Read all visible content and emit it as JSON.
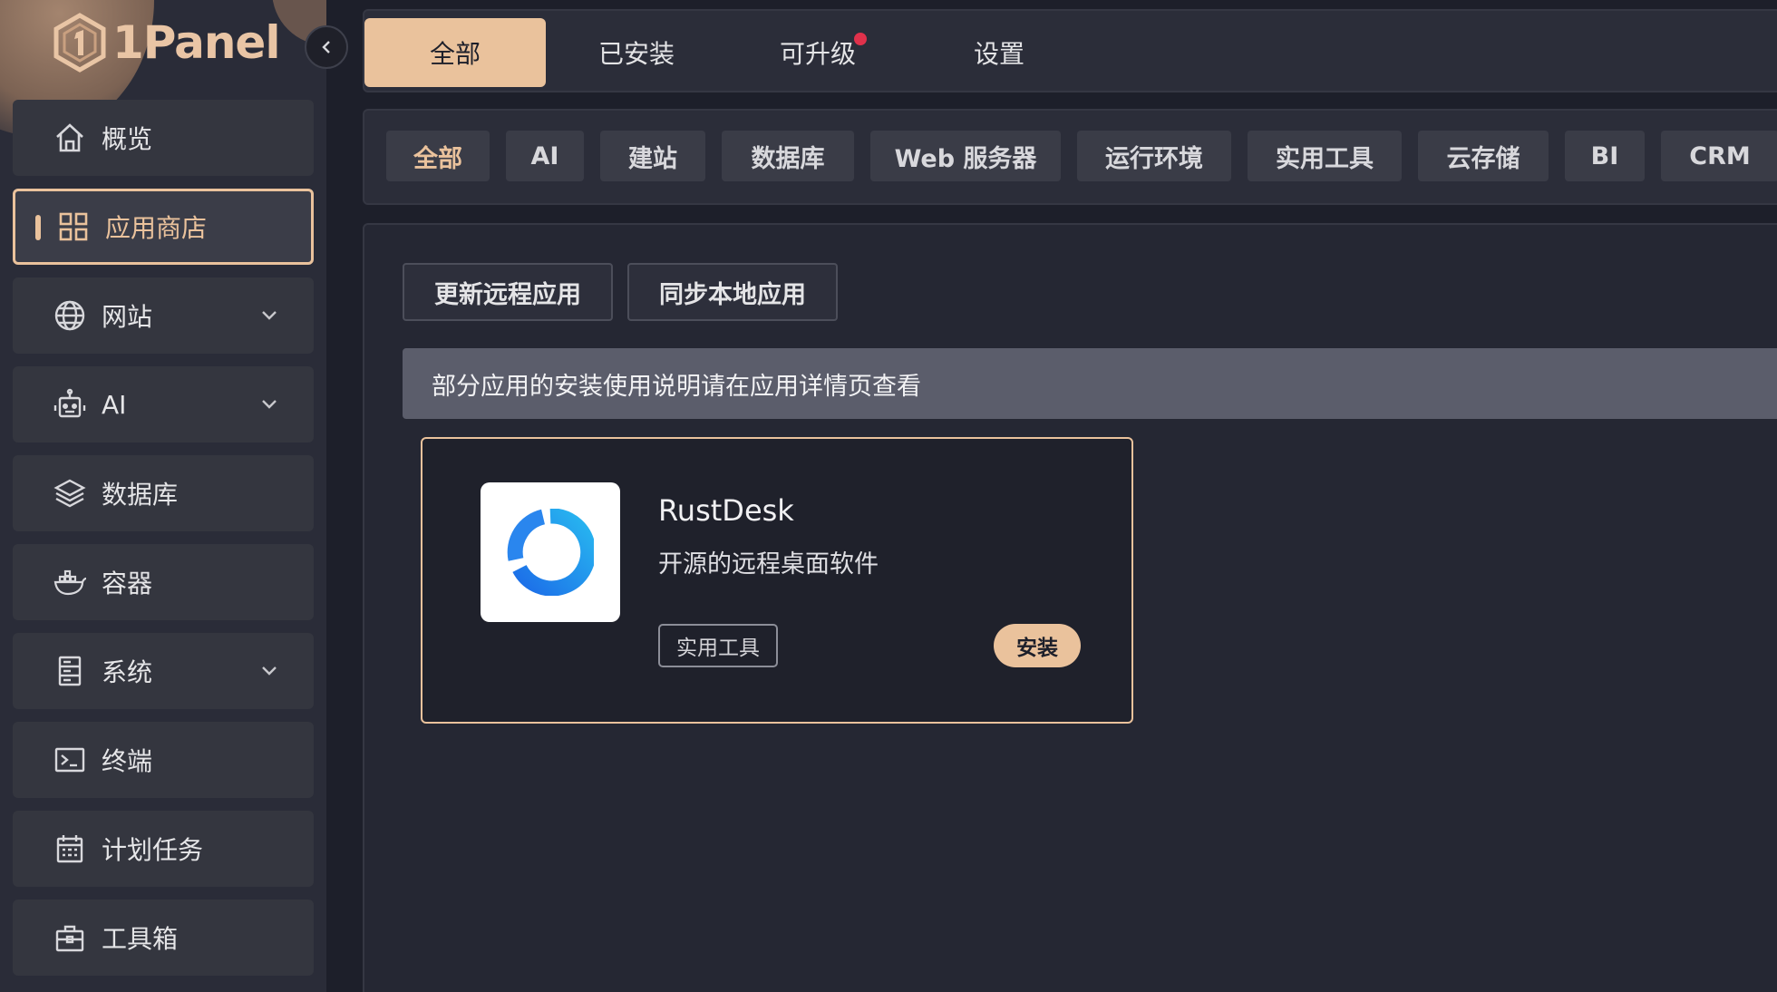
{
  "app": {
    "logo_text": "1Panel"
  },
  "sidebar": {
    "items": [
      {
        "label": "概览",
        "icon": "home-icon",
        "expandable": false
      },
      {
        "label": "应用商店",
        "icon": "apps-grid-icon",
        "expandable": false,
        "active": true
      },
      {
        "label": "网站",
        "icon": "globe-icon",
        "expandable": true
      },
      {
        "label": "AI",
        "icon": "robot-icon",
        "expandable": true
      },
      {
        "label": "数据库",
        "icon": "layers-icon",
        "expandable": false
      },
      {
        "label": "容器",
        "icon": "docker-icon",
        "expandable": false
      },
      {
        "label": "系统",
        "icon": "server-icon",
        "expandable": true
      },
      {
        "label": "终端",
        "icon": "terminal-icon",
        "expandable": false
      },
      {
        "label": "计划任务",
        "icon": "calendar-icon",
        "expandable": false
      },
      {
        "label": "工具箱",
        "icon": "toolbox-icon",
        "expandable": false
      }
    ]
  },
  "tabs": [
    {
      "label": "全部",
      "active": true
    },
    {
      "label": "已安装"
    },
    {
      "label": "可升级",
      "badge_dot": true
    },
    {
      "label": "设置"
    }
  ],
  "categories": [
    "全部",
    "AI",
    "建站",
    "数据库",
    "Web 服务器",
    "运行环境",
    "实用工具",
    "云存储",
    "BI",
    "CRM"
  ],
  "actions": {
    "update_remote": "更新远程应用",
    "sync_local": "同步本地应用"
  },
  "notice": "部分应用的安装使用说明请在应用详情页查看",
  "app_card": {
    "name": "RustDesk",
    "description": "开源的远程桌面软件",
    "tag": "实用工具",
    "install_label": "安装"
  },
  "colors": {
    "accent": "#eac29c",
    "background": "#1d1f2a",
    "panel": "#2b2d39",
    "badge": "#e0314b"
  }
}
